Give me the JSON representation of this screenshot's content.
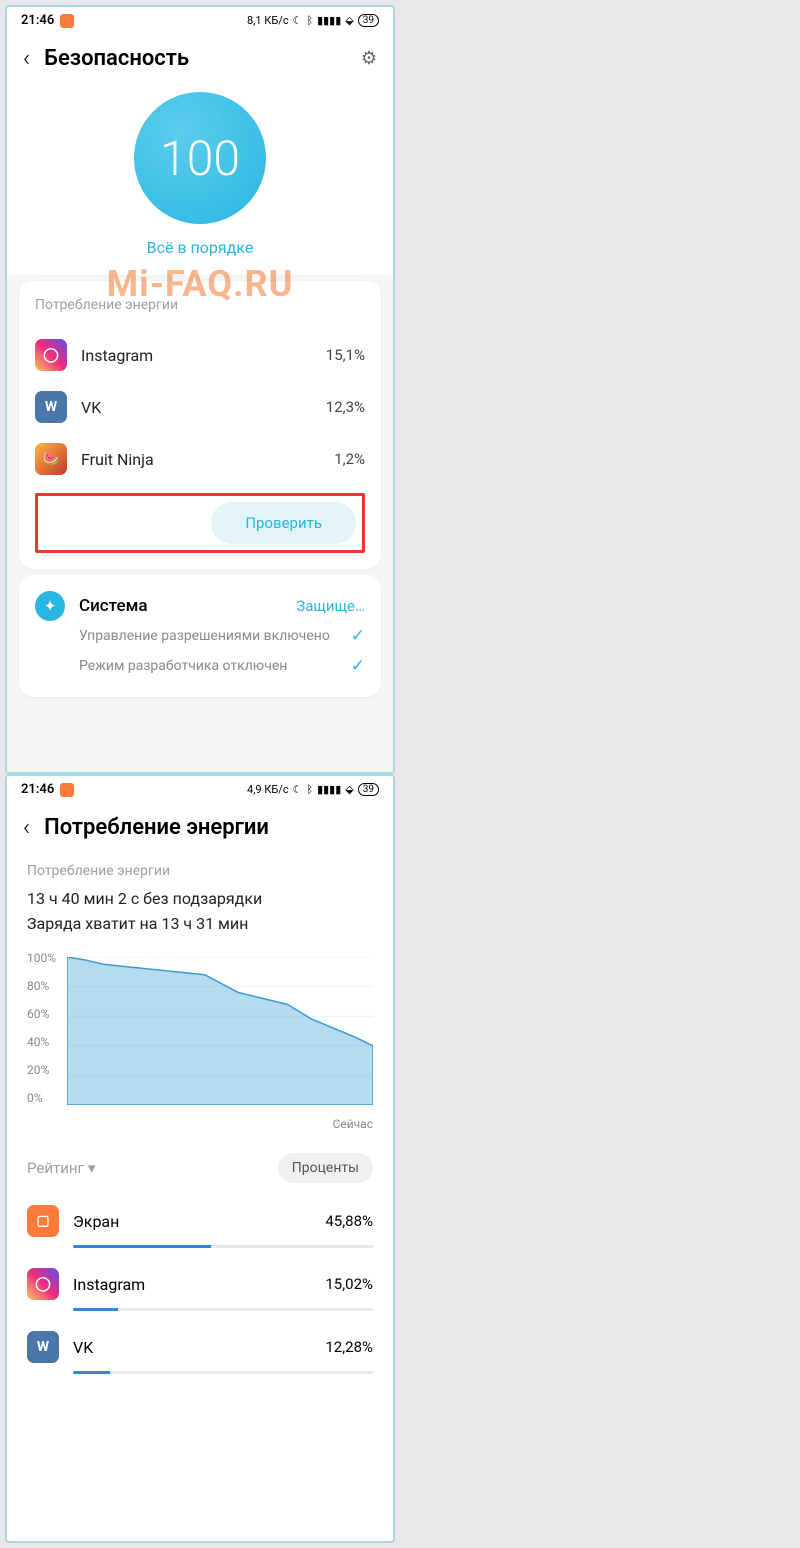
{
  "watermark": "Mi-FAQ.RU",
  "left": {
    "statusbar": {
      "time": "21:46",
      "net": "8,1 КБ/с",
      "batt": "39"
    },
    "title": "Безопасность",
    "score": "100",
    "status_text": "Всё в порядке",
    "energy_section": "Потребление энергии",
    "apps": [
      {
        "name": "Instagram",
        "pct": "15,1%"
      },
      {
        "name": "VK",
        "pct": "12,3%"
      },
      {
        "name": "Fruit Ninja",
        "pct": "1,2%"
      }
    ],
    "check_btn": "Проверить",
    "system": {
      "title": "Система",
      "status": "Защище…",
      "items": [
        "Управление разрешениями включено",
        "Режим разработчика отключен"
      ]
    }
  },
  "right": {
    "statusbar": {
      "time": "21:46",
      "net": "4,9 КБ/с",
      "batt": "39"
    },
    "title": "Потребление энергии",
    "sub_label": "Потребление энергии",
    "line1": "13 ч 40 мин 2 с без подзарядки",
    "line2": "Заряда хватит на 13 ч 31 мин",
    "ylabels": [
      "100%",
      "80%",
      "60%",
      "40%",
      "20%",
      "0%"
    ],
    "xlabel": "Сейчас",
    "filter_label": "Рейтинг",
    "filter_mode": "Проценты",
    "usage": [
      {
        "name": "Экран",
        "pct": "45,88%",
        "fill": 45.88
      },
      {
        "name": "Instagram",
        "pct": "15,02%",
        "fill": 15.02
      },
      {
        "name": "VK",
        "pct": "12,28%",
        "fill": 12.28
      }
    ]
  },
  "chart_data": {
    "type": "area",
    "title": "Потребление энергии",
    "ylabel": "%",
    "ylim": [
      0,
      100
    ],
    "x": [
      0,
      0.06,
      0.12,
      0.45,
      0.56,
      0.72,
      0.8,
      0.94,
      1.0
    ],
    "values": [
      100,
      98,
      95,
      88,
      76,
      68,
      58,
      46,
      40
    ]
  }
}
